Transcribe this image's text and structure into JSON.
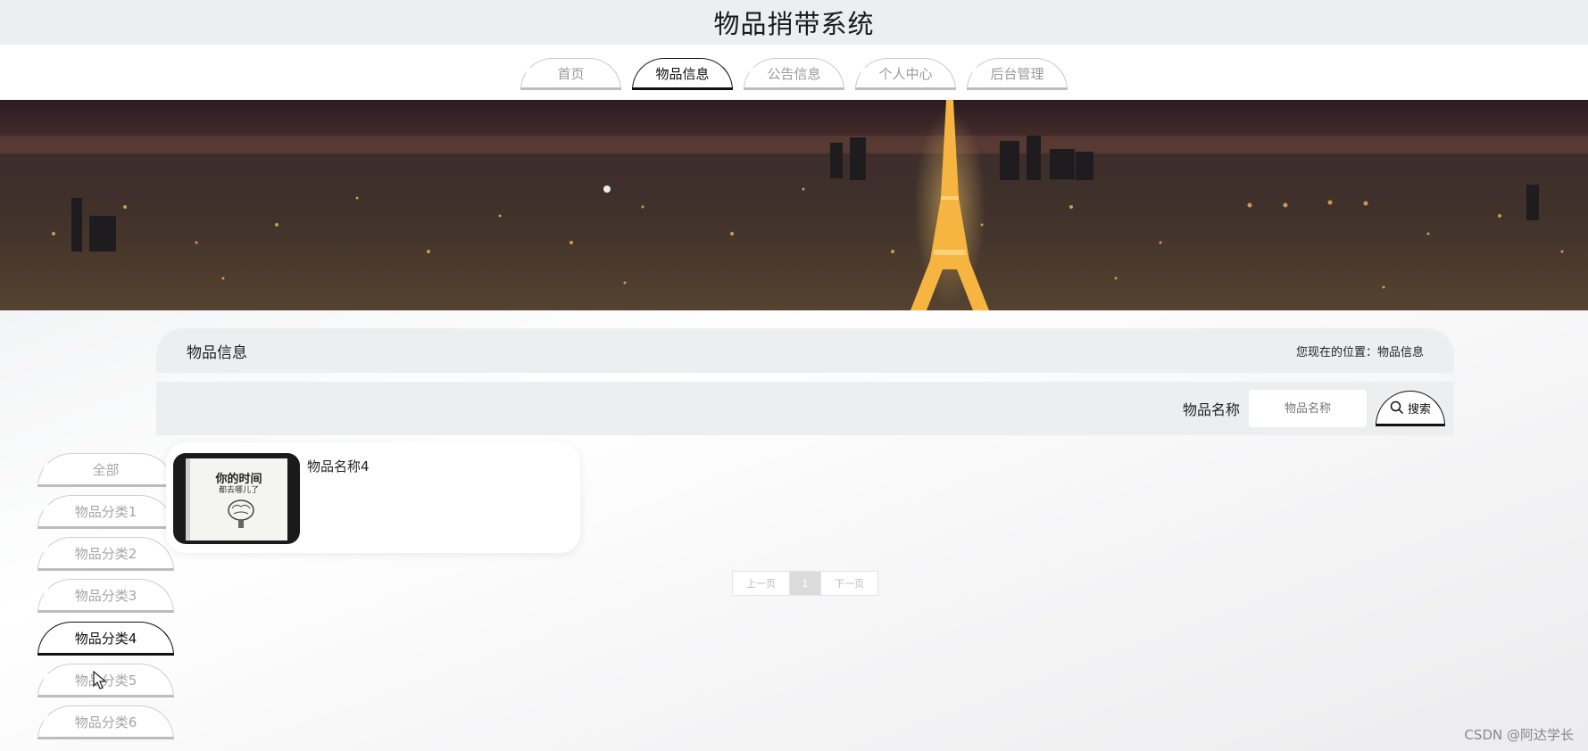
{
  "app_title": "物品捎带系统",
  "nav": {
    "items": [
      {
        "label": "首页",
        "active": false
      },
      {
        "label": "物品信息",
        "active": true
      },
      {
        "label": "公告信息",
        "active": false
      },
      {
        "label": "个人中心",
        "active": false
      },
      {
        "label": "后台管理",
        "active": false
      }
    ]
  },
  "section": {
    "title": "物品信息",
    "breadcrumb": "您现在的位置：物品信息"
  },
  "search": {
    "label": "物品名称",
    "placeholder": "物品名称",
    "button_label": "搜索"
  },
  "categories": [
    {
      "label": "全部",
      "active": false
    },
    {
      "label": "物品分类1",
      "active": false
    },
    {
      "label": "物品分类2",
      "active": false
    },
    {
      "label": "物品分类3",
      "active": false
    },
    {
      "label": "物品分类4",
      "active": true
    },
    {
      "label": "物品分类5",
      "active": false
    },
    {
      "label": "物品分类6",
      "active": false
    }
  ],
  "items": [
    {
      "name": "物品名称4",
      "cover_title": "你的时间",
      "cover_subtitle": "都去哪儿了"
    }
  ],
  "pagination": {
    "prev_label": "上一页",
    "current_page": "1",
    "next_label": "下一页"
  },
  "watermark": "CSDN @阿达学长",
  "colors": {
    "active_border": "#111111",
    "inactive_text": "#a6a6a6",
    "header_bg": "#eceef0"
  }
}
